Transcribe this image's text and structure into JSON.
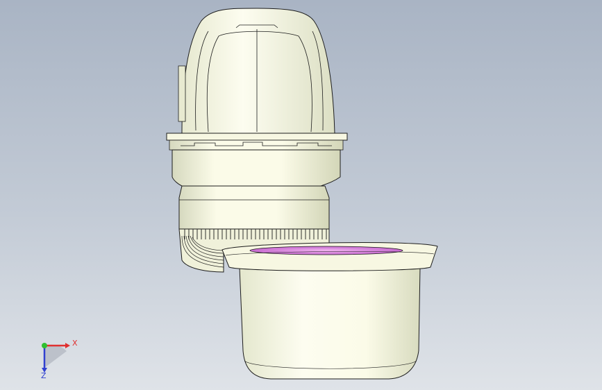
{
  "viewport": {
    "background_top": "#a9b4c4",
    "background_bottom": "#dfe3e8",
    "model": {
      "parts": [
        "dome-cap",
        "collar-ring",
        "body-cylinder",
        "vent-ring",
        "side-cup"
      ],
      "body_color": "#fbfbe8",
      "shade_color": "#d9dcc0",
      "edge_color": "#1c1c1c",
      "inner_rim_color": "#d27fd6"
    }
  },
  "triad": {
    "x_label": "X",
    "z_label": "Z",
    "x_color": "#e03030",
    "y_color": "#30c030",
    "z_color": "#3040d0"
  }
}
